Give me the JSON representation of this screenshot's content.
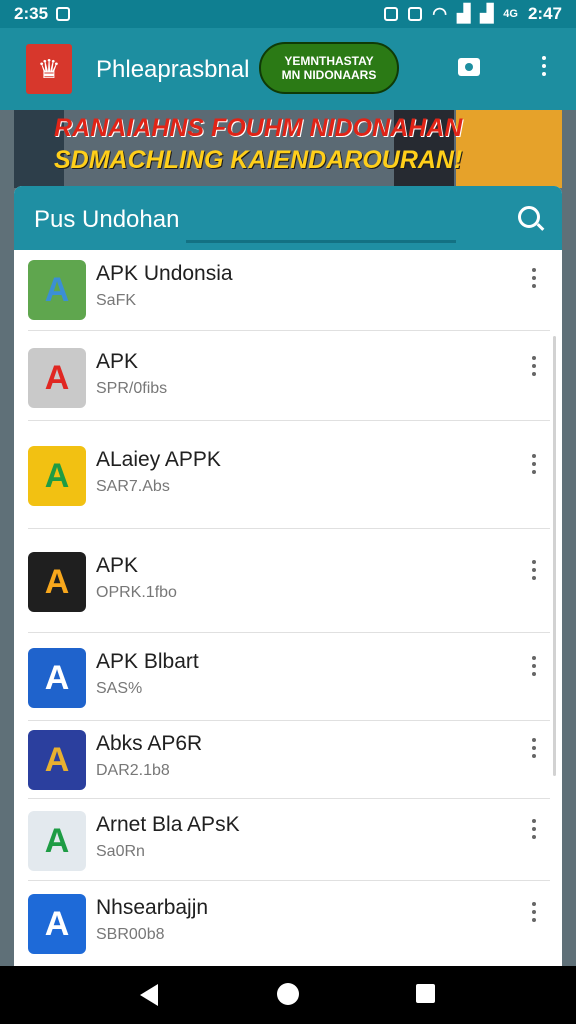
{
  "status": {
    "time_left": "2:35",
    "time_right": "2:47",
    "net": "4G"
  },
  "appbar": {
    "title": "Phleaprasbnal",
    "pill_line1": "YEMNTHASTAY",
    "pill_line2": "MN NIDONAARS",
    "logo_icon": "crown-logo-icon"
  },
  "banner": {
    "line1": "RANAIAHNS FOUHM NIDONAHAN",
    "line2": "SDMACHLING KAIENDAROURAN!"
  },
  "list": {
    "title": "Pus Undohan",
    "items": [
      {
        "name": "APK Undonsia",
        "sub": "SaFK",
        "icon": "landscape-icon",
        "colors": [
          "#5fa64e",
          "#3b8fd4"
        ]
      },
      {
        "name": "APK",
        "sub": "SPR/0fibs",
        "icon": "red-a-icon",
        "colors": [
          "#c9c9c9",
          "#e02722"
        ]
      },
      {
        "name": "ALaiey APPK",
        "sub": "SAR7.Abs",
        "icon": "triangle-icon",
        "colors": [
          "#f2c112",
          "#1e9c44"
        ]
      },
      {
        "name": "APK",
        "sub": "OPRK.1fbo",
        "icon": "g-letter-icon",
        "colors": [
          "#1f1f1f",
          "#f7a71c"
        ]
      },
      {
        "name": "APK Blbart",
        "sub": "SAS%",
        "icon": "blue-a-icon",
        "colors": [
          "#1f63cc",
          "#ffffff"
        ]
      },
      {
        "name": "Abks AP6R",
        "sub": "DAR2.1b8",
        "icon": "compass-icon",
        "colors": [
          "#2b3f9e",
          "#e8b030"
        ]
      },
      {
        "name": "Arnet Bla APsK",
        "sub": "Sa0Rn",
        "icon": "green-a-icon",
        "colors": [
          "#e3e9ee",
          "#1e9c44"
        ]
      },
      {
        "name": "Nhsearbajjn",
        "sub": "SBR00b8",
        "icon": "shield-a-icon",
        "colors": [
          "#1e6ad8",
          "#ffffff"
        ]
      }
    ]
  }
}
